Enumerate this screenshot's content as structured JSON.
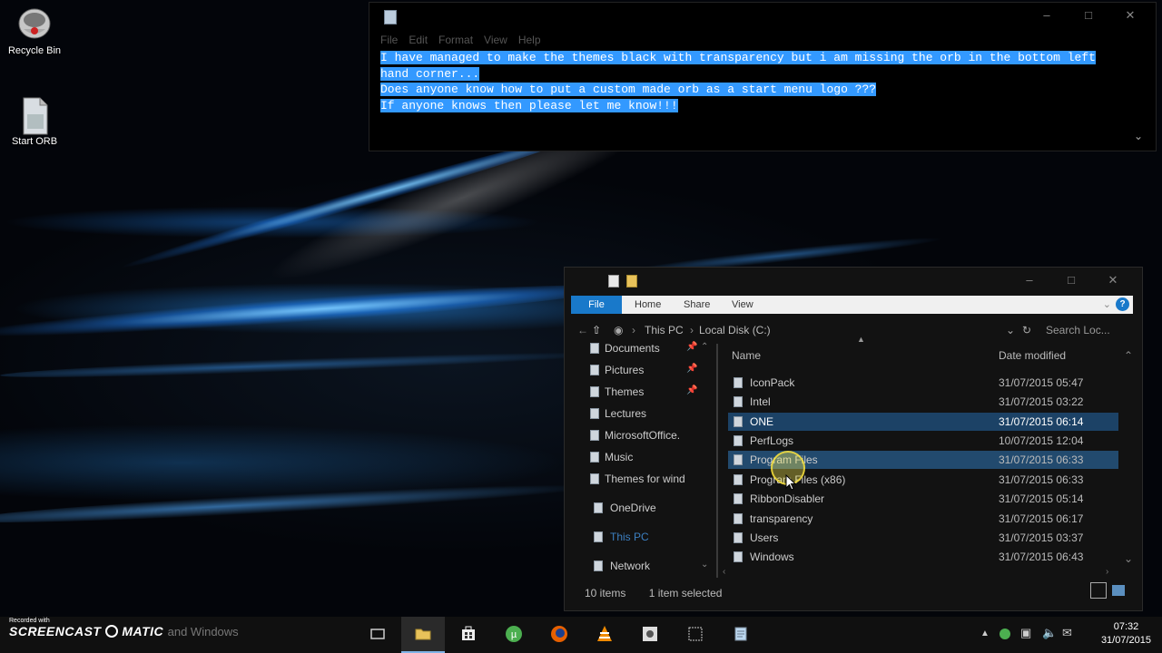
{
  "desktop": {
    "icons": [
      {
        "label": "Recycle Bin",
        "icon": "recycle-bin-icon"
      },
      {
        "label": "Start ORB",
        "icon": "file-icon"
      }
    ]
  },
  "notepad": {
    "title": "",
    "menu": [
      "File",
      "Edit",
      "Format",
      "View",
      "Help"
    ],
    "lines": [
      "I have managed to make the themes black with transparency but i am missing the orb in the bottom left",
      "hand corner...",
      "Does anyone know how to put a custom made orb as a start menu logo ???",
      "If anyone knows then please let me know!!!"
    ]
  },
  "explorer": {
    "ribbon_tabs": [
      "File",
      "Home",
      "Share",
      "View"
    ],
    "help": "?",
    "breadcrumb": [
      "This PC",
      "Local Disk (C:)"
    ],
    "search_placeholder": "Search Loc...",
    "nav": [
      {
        "label": "Documents",
        "pinned": true
      },
      {
        "label": "Pictures",
        "pinned": true
      },
      {
        "label": "Themes",
        "pinned": true
      },
      {
        "label": "Lectures",
        "pinned": false
      },
      {
        "label": "MicrosoftOffice.",
        "pinned": false
      },
      {
        "label": "Music",
        "pinned": false
      },
      {
        "label": "Themes for wind",
        "pinned": false
      },
      {
        "label": "OneDrive",
        "pinned": false
      },
      {
        "label": "This PC",
        "pinned": false
      },
      {
        "label": "Network",
        "pinned": false
      }
    ],
    "columns": {
      "name": "Name",
      "date": "Date modified"
    },
    "files": [
      {
        "name": "IconPack",
        "date": "31/07/2015 05:47"
      },
      {
        "name": "Intel",
        "date": "31/07/2015 03:22"
      },
      {
        "name": "ONE",
        "date": "31/07/2015 06:14"
      },
      {
        "name": "PerfLogs",
        "date": "10/07/2015 12:04"
      },
      {
        "name": "Program Files",
        "date": "31/07/2015 06:33"
      },
      {
        "name": "Program Files (x86)",
        "date": "31/07/2015 06:33"
      },
      {
        "name": "RibbonDisabler",
        "date": "31/07/2015 05:14"
      },
      {
        "name": "transparency",
        "date": "31/07/2015 06:17"
      },
      {
        "name": "Users",
        "date": "31/07/2015 03:37"
      },
      {
        "name": "Windows",
        "date": "31/07/2015 06:43"
      }
    ],
    "status": {
      "items": "10 items",
      "selected": "1 item selected"
    }
  },
  "watermark": {
    "recorded": "Recorded with",
    "brand": "SCREENCAST",
    "brand2": "MATIC",
    "extra": "and Windows"
  },
  "clock": {
    "time": "07:32",
    "date": "31/07/2015"
  },
  "colors": {
    "accent": "#1979ca",
    "selection": "#3399ff",
    "row_highlight": "#1c4266"
  }
}
